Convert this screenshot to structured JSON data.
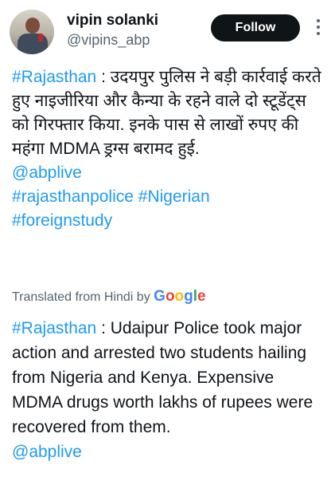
{
  "user": {
    "name": "vipin solanki",
    "handle": "@vipins_abp",
    "follow_label": "Follow"
  },
  "tweet": {
    "hashtag_state": "#Rajasthan",
    "hindi_body": "  : उदयपुर पुलिस ने बड़ी कार्रवाई करते हुए नाइजीरिया और कैन्या के रहने वाले दो स्टूडेंट्स को गिरफ्तार किया. इनके पास से लाखों रुपए की महंगा MDMA ड्रग्स बरामद हुई.",
    "mention": "@abplive",
    "hashtag_police": "#rajasthanpolice",
    "hashtag_nigerian": "#Nigerian",
    "hashtag_study": "#foreignstudy"
  },
  "translation": {
    "label": "Translated from Hindi by",
    "brand": "Google",
    "hashtag_state": "#Rajasthan",
    "body": " : Udaipur Police took major action and arrested two students hailing from Nigeria and Kenya. Expensive MDMA drugs worth lakhs of rupees were recovered from them.",
    "mention": "@abplive"
  },
  "icons": {
    "avatar": "profile-photo",
    "more": "more-vertical-icon"
  },
  "colors": {
    "link": "#1d9bf0",
    "follow_bg": "#0f1419",
    "secondary_text": "#536471"
  }
}
